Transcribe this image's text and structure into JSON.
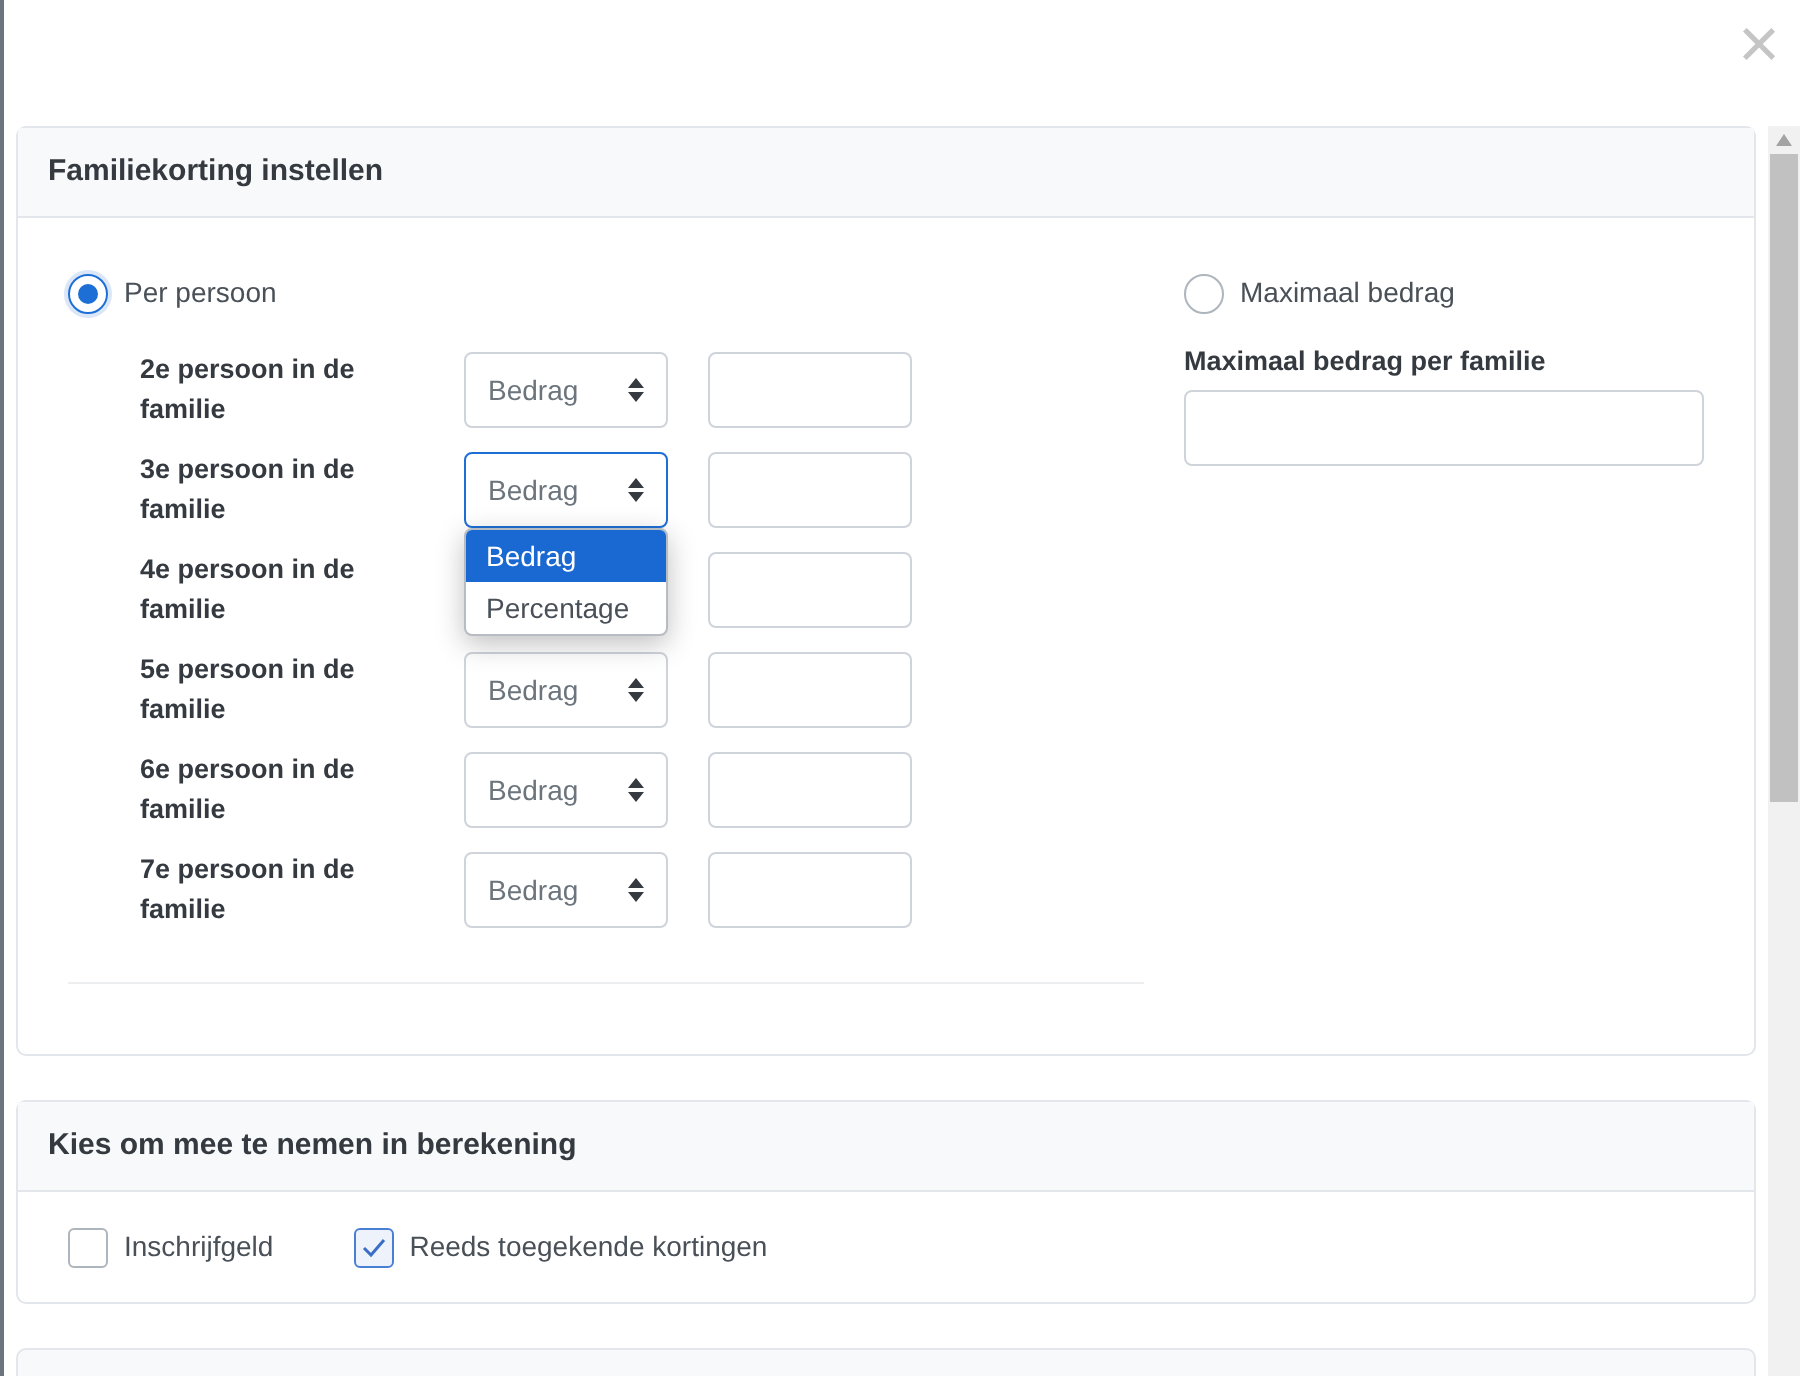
{
  "close_button": {
    "label": "×"
  },
  "discount_panel": {
    "title": "Familiekorting instellen",
    "modes": [
      {
        "label": "Per persoon",
        "selected": true
      },
      {
        "label": "Maximaal bedrag",
        "selected": false
      }
    ],
    "rows": [
      {
        "label": "2e persoon in de familie",
        "type": "Bedrag"
      },
      {
        "label": "3e persoon in de familie",
        "type": "Bedrag",
        "options": [
          {
            "label": "Bedrag",
            "selected": true
          },
          {
            "label": "Percentage",
            "selected": false
          }
        ]
      },
      {
        "label": "4e persoon in de familie"
      },
      {
        "label": "5e persoon in de familie",
        "type": "Bedrag"
      },
      {
        "label": "6e persoon in de familie",
        "type": "Bedrag"
      },
      {
        "label": "7e persoon in de familie",
        "type": "Bedrag"
      }
    ],
    "max_label": "Maximaal bedrag per familie"
  },
  "include_panel": {
    "title": "Kies om mee te nemen in berekening",
    "options": [
      {
        "label": "Inschrijfgeld",
        "checked": false
      },
      {
        "label": "Reeds toegekende kortingen",
        "checked": true
      }
    ]
  }
}
